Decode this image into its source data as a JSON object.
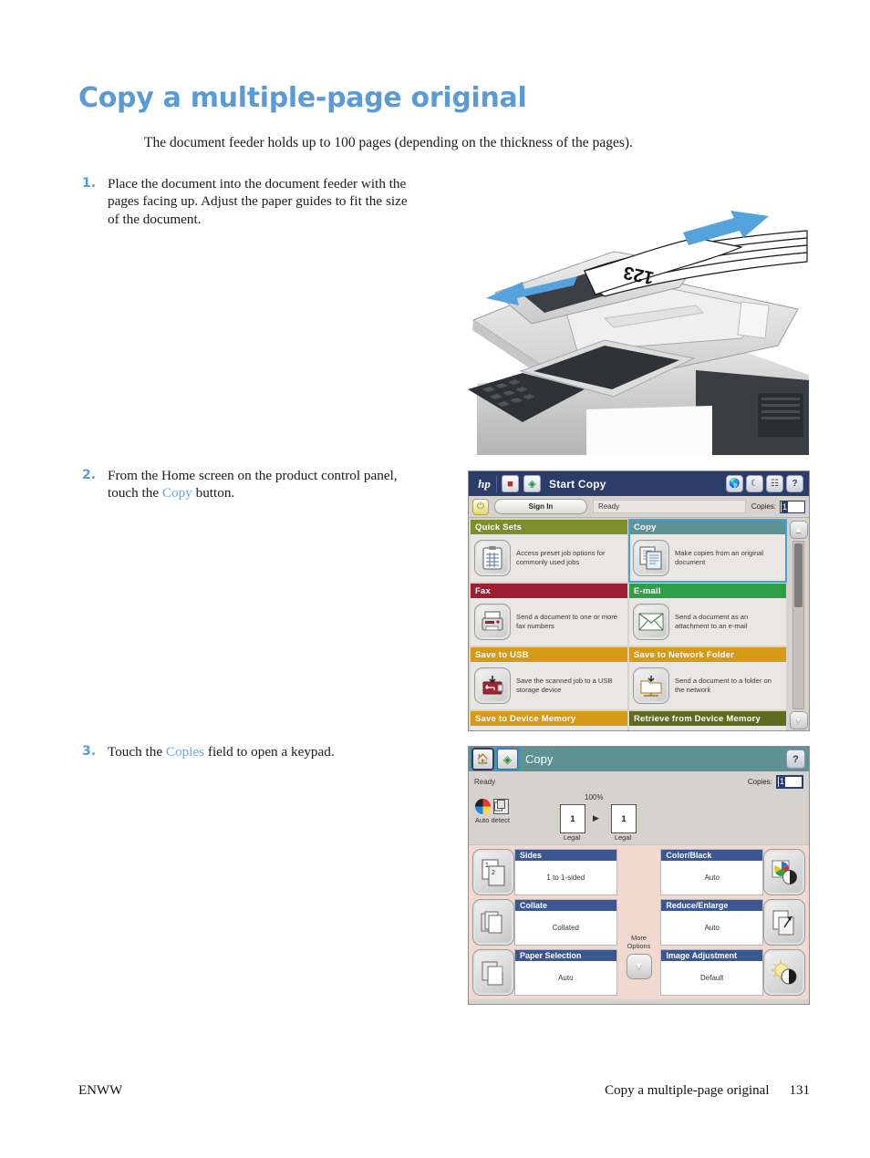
{
  "document": {
    "title": "Copy a multiple-page original",
    "intro": "The document feeder holds up to 100 pages (depending on the thickness of the pages).",
    "accent_color": "#5b9bd5",
    "steps": [
      {
        "number": "1.",
        "text_before": "Place the document into the document feeder with the pages facing up. Adjust the paper guides to fit the size of the document.",
        "ref": "",
        "text_after": ""
      },
      {
        "number": "2.",
        "text_before": "From the Home screen on the product control panel, touch the ",
        "ref": "Copy",
        "text_after": " button."
      },
      {
        "number": "3.",
        "text_before": "Touch the ",
        "ref": "Copies",
        "text_after": " field to open a keypad."
      }
    ],
    "footer": {
      "left": "ENWW",
      "center": "Copy a multiple-page original",
      "page": "131"
    }
  },
  "photo": {
    "caption": "HP multifunction printer document feeder loading illustration",
    "page_mark": "123",
    "arrow_color": "#54a3dd"
  },
  "home_screen": {
    "logo": "hp",
    "stop_icon": "stop-icon",
    "start_icon": "start-icon",
    "title": "Start Copy",
    "header_bg": "#2b3c6b",
    "top_icons": [
      "globe-icon",
      "sleep-icon",
      "network-icon",
      "help-icon"
    ],
    "sign_in_label": "Sign In",
    "status": "Ready",
    "copies_label": "Copies:",
    "copies_value": "1",
    "tiles": [
      {
        "title": "Quick Sets",
        "color": "#7d8f2a",
        "desc": "Access preset job options for commonly used jobs",
        "icon": "quick-sets-icon",
        "selected": false
      },
      {
        "title": "Copy",
        "color": "#5e9396",
        "desc": "Make copies from an original document",
        "icon": "copy-icon",
        "selected": true
      },
      {
        "title": "Fax",
        "color": "#9e1f32",
        "desc": "Send a document to one or more fax numbers",
        "icon": "fax-icon",
        "selected": false
      },
      {
        "title": "E-mail",
        "color": "#2e9e47",
        "desc": "Send a document as an attachment to an e-mail",
        "icon": "email-icon",
        "selected": false
      },
      {
        "title": "Save to USB",
        "color": "#d79a16",
        "desc": "Save the scanned job to a USB storage device",
        "icon": "usb-icon",
        "selected": false
      },
      {
        "title": "Save to Network Folder",
        "color": "#d79a16",
        "desc": "Send a document to a folder on the network",
        "icon": "network-folder-icon",
        "selected": false
      },
      {
        "title": "Save to Device Memory",
        "color": "#d79a16",
        "desc": "",
        "icon": "device-memory-icon",
        "selected": false
      },
      {
        "title": "Retrieve from Device Memory",
        "color": "#5f6b1e",
        "desc": "",
        "icon": "retrieve-memory-icon",
        "selected": false
      }
    ],
    "scroll_up": "scroll-up-icon",
    "scroll_down": "scroll-down-icon"
  },
  "copy_screen": {
    "home_icon": "home-icon",
    "start_icon": "start-icon",
    "title": "Copy",
    "help_icon": "help-icon",
    "header_bg": "#5e9396",
    "status": "Ready",
    "copies_label": "Copies:",
    "copies_value": "1",
    "preview": {
      "auto_detect_label": "Auto detect",
      "scale": "100%",
      "source_page": "1",
      "source_size": "Legal",
      "dest_page": "1",
      "dest_size": "Legal"
    },
    "more_options_label": "More Options",
    "more_options_icon": "chevron-down-icon",
    "options": [
      {
        "title": "Sides",
        "value": "1 to 1-sided",
        "icon": "sides-icon",
        "side": "left"
      },
      {
        "title": "Collate",
        "value": "Collated",
        "icon": "collate-icon",
        "side": "left"
      },
      {
        "title": "Paper Selection",
        "value": "Auto",
        "icon": "paper-selection-icon",
        "side": "left"
      },
      {
        "title": "Color/Black",
        "value": "Auto",
        "icon": "color-black-icon",
        "side": "right"
      },
      {
        "title": "Reduce/Enlarge",
        "value": "Auto",
        "icon": "reduce-enlarge-icon",
        "side": "right"
      },
      {
        "title": "Image Adjustment",
        "value": "Default",
        "icon": "image-adjustment-icon",
        "side": "right"
      }
    ]
  }
}
